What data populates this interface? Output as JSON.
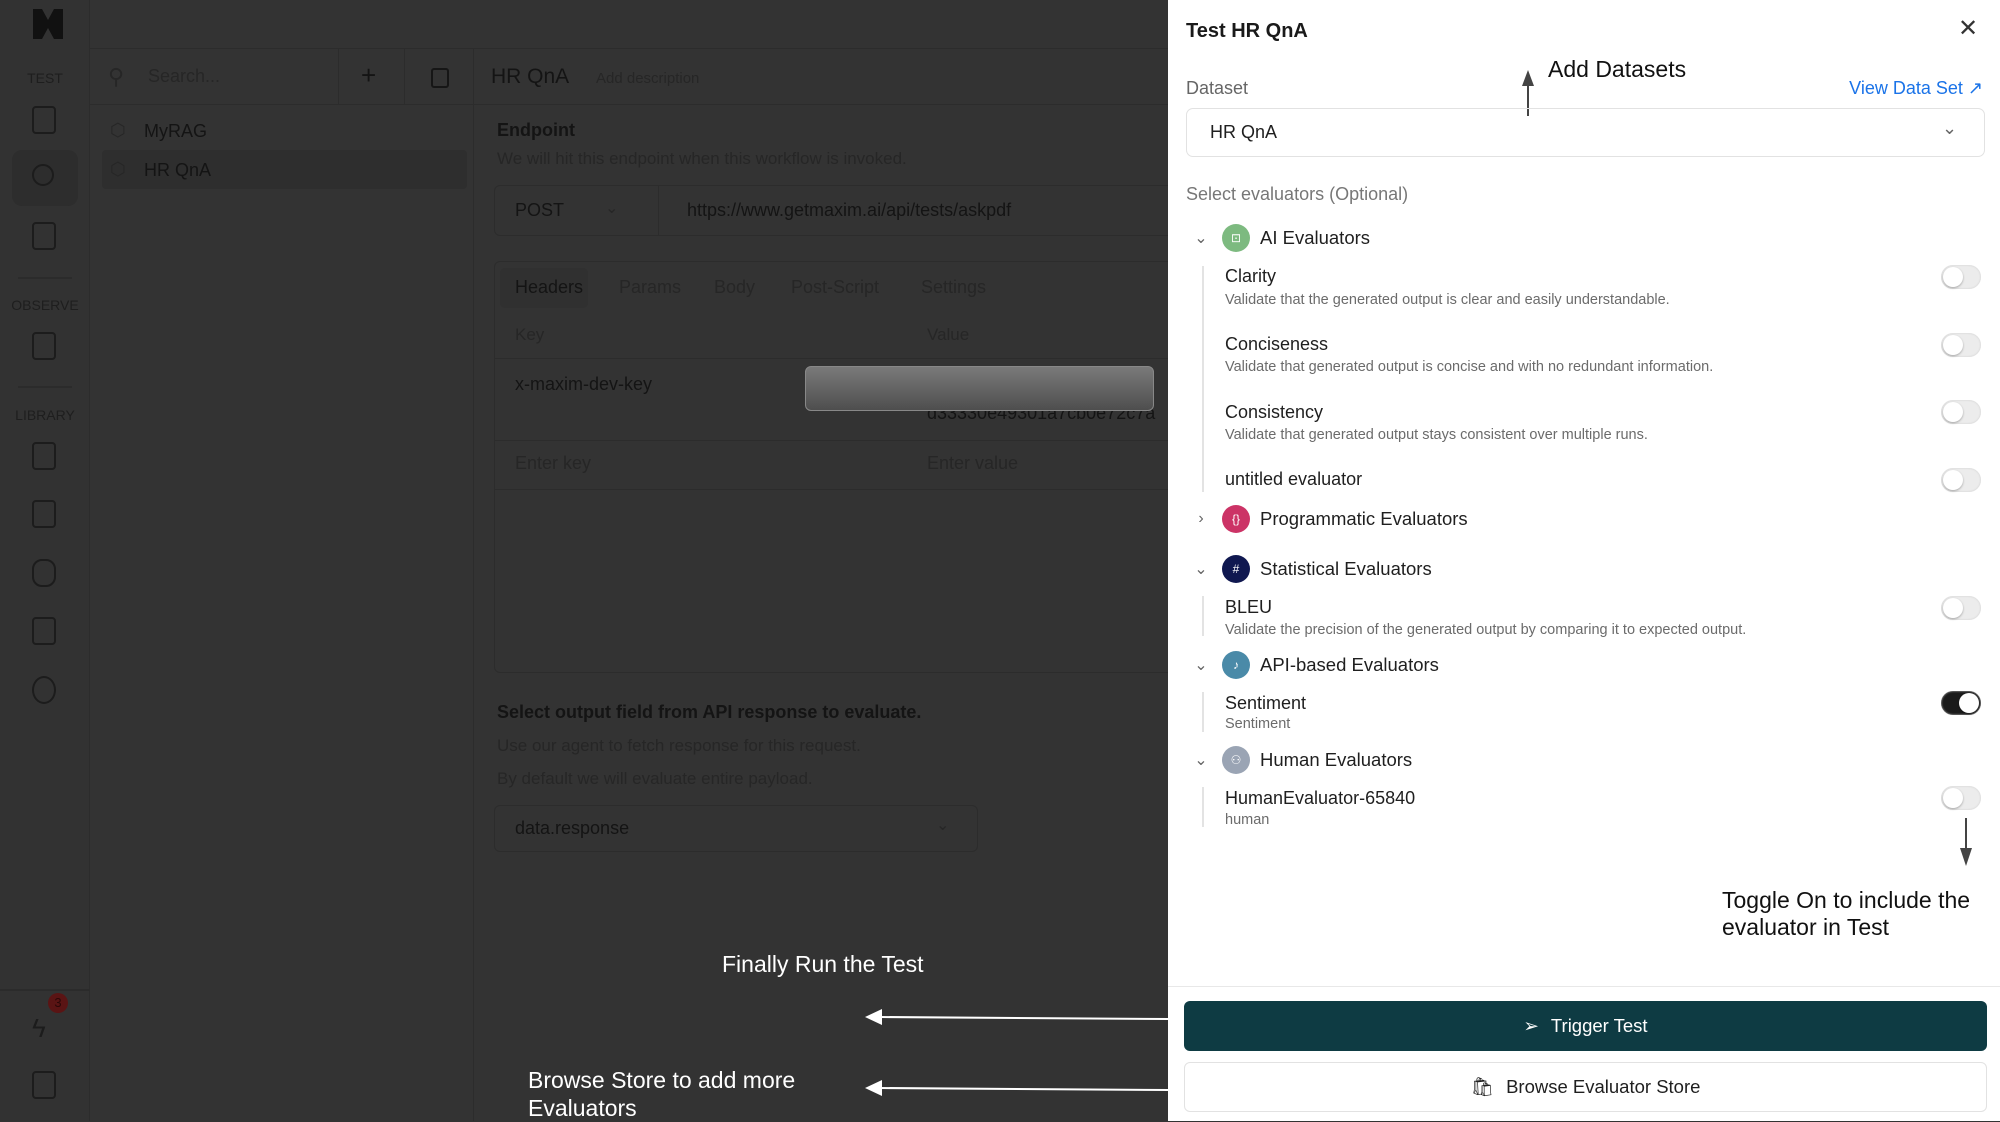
{
  "rail": {
    "sections": [
      "TEST",
      "OBSERVE",
      "LIBRARY"
    ],
    "badge_count": "3"
  },
  "sidebar": {
    "search_placeholder": "Search...",
    "items": [
      {
        "label": "MyRAG"
      },
      {
        "label": "HR QnA",
        "selected": true
      }
    ]
  },
  "header": {
    "title": "HR QnA",
    "add_description": "Add description"
  },
  "endpoint": {
    "title": "Endpoint",
    "subtitle": "We will hit this endpoint when this workflow is invoked.",
    "method": "POST",
    "url": "https://www.getmaxim.ai/api/tests/askpdf"
  },
  "request_tabs": [
    "Headers",
    "Params",
    "Body",
    "Post-Script",
    "Settings"
  ],
  "headers_table": {
    "columns": [
      "Key",
      "Value"
    ],
    "rows": [
      {
        "key": "x-maxim-dev-key",
        "value_partial": "d33330e49301a7cb0e72c7a"
      }
    ],
    "key_placeholder": "Enter key",
    "value_placeholder": "Enter value"
  },
  "output": {
    "title": "Select output field from API response to evaluate.",
    "line1": "Use our agent to fetch response for this request.",
    "line2": "By default we will evaluate entire payload.",
    "selected": "data.response"
  },
  "panel": {
    "title": "Test HR QnA",
    "dataset_label": "Dataset",
    "view_dataset": "View Data Set ↗",
    "dataset_value": "HR QnA",
    "evaluators_label": "Select evaluators (Optional)",
    "groups": [
      {
        "name": "AI Evaluators",
        "color": "#7dba80",
        "expanded": true,
        "items": [
          {
            "name": "Clarity",
            "desc": "Validate that the generated output is clear and easily understandable.",
            "on": false
          },
          {
            "name": "Conciseness",
            "desc": "Validate that generated output is concise and with no redundant information.",
            "on": false
          },
          {
            "name": "Consistency",
            "desc": "Validate that generated output stays consistent over multiple runs.",
            "on": false
          },
          {
            "name": "untitled evaluator",
            "on": false
          }
        ]
      },
      {
        "name": "Programmatic Evaluators",
        "color": "#cc3366",
        "expanded": false
      },
      {
        "name": "Statistical Evaluators",
        "color": "#101850",
        "expanded": true,
        "items": [
          {
            "name": "BLEU",
            "desc": "Validate the precision of the generated output by comparing it to expected output.",
            "on": false
          }
        ]
      },
      {
        "name": "API-based Evaluators",
        "color": "#4a8aa8",
        "expanded": true,
        "items": [
          {
            "name": "Sentiment",
            "desc": "Sentiment",
            "on": true
          }
        ]
      },
      {
        "name": "Human Evaluators",
        "color": "#9aa4b4",
        "expanded": true,
        "items": [
          {
            "name": "HumanEvaluator-65840",
            "desc": "human",
            "on": false
          }
        ]
      }
    ],
    "trigger": "Trigger Test",
    "browse": "Browse Evaluator Store",
    "primary_color": "#0e3b43"
  },
  "annotations": {
    "add_datasets": "Add Datasets",
    "toggle_line1": "Toggle On to include the",
    "toggle_line2": "evaluator in Test",
    "run_test": "Finally Run the Test",
    "browse_line1": "Browse Store to add more",
    "browse_line2": "Evaluators"
  }
}
